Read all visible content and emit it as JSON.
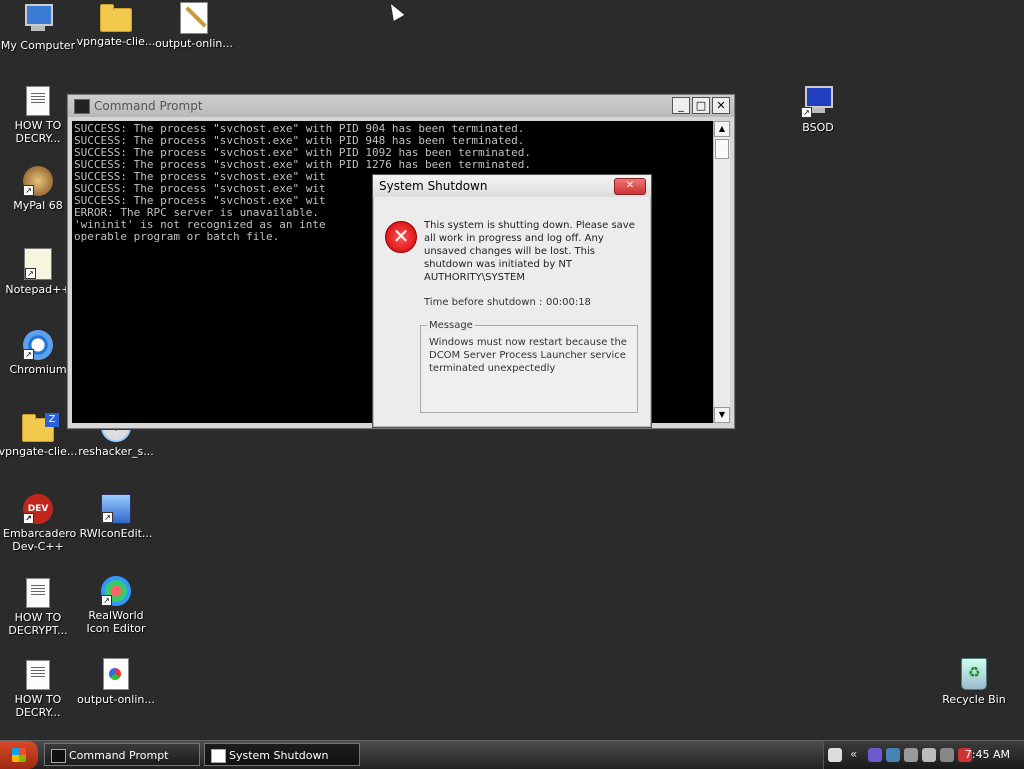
{
  "desktop_icons": [
    {
      "label": "My Computer",
      "icon": "computer-icon"
    },
    {
      "label": "vpngate-clie...",
      "icon": "folder-icon"
    },
    {
      "label": "output-onlin...",
      "icon": "paint-icon"
    },
    {
      "label": "HOW TO DECRY...",
      "icon": "text-file-icon"
    },
    {
      "label": "MyPal 68",
      "icon": "browser-icon"
    },
    {
      "label": "Notepad++",
      "icon": "notepad-icon"
    },
    {
      "label": "Chromium",
      "icon": "chromium-icon"
    },
    {
      "label": "vpngate-clie...",
      "icon": "zip-folder-icon"
    },
    {
      "label": "reshacker_s...",
      "icon": "cd-icon"
    },
    {
      "label": "Embarcadero Dev-C++",
      "icon": "dev-cpp-icon"
    },
    {
      "label": "RWIconEdit...",
      "icon": "setup-icon"
    },
    {
      "label": "HOW TO DECRYPT...",
      "icon": "text-file-icon"
    },
    {
      "label": "RealWorld Icon Editor",
      "icon": "icon-editor-icon"
    },
    {
      "label": "HOW TO DECRY...",
      "icon": "text-file-icon"
    },
    {
      "label": "output-onlin...",
      "icon": "image-file-icon"
    },
    {
      "label": "BSOD",
      "icon": "bsod-icon"
    },
    {
      "label": "Recycle Bin",
      "icon": "recycle-bin-icon"
    }
  ],
  "cmd_window": {
    "title": "Command Prompt",
    "lines": [
      "SUCCESS: The process \"svchost.exe\" with PID 904 has been terminated.",
      "SUCCESS: The process \"svchost.exe\" with PID 948 has been terminated.",
      "SUCCESS: The process \"svchost.exe\" with PID 1092 has been terminated.",
      "SUCCESS: The process \"svchost.exe\" with PID 1276 has been terminated.",
      "SUCCESS: The process \"svchost.exe\" wit",
      "SUCCESS: The process \"svchost.exe\" wit",
      "SUCCESS: The process \"svchost.exe\" wit",
      "ERROR: The RPC server is unavailable.",
      "'wininit' is not recognized as an inte",
      "operable program or batch file."
    ]
  },
  "shutdown_dialog": {
    "title": "System Shutdown",
    "message": "This system is shutting down. Please save all work in progress and log off. Any unsaved changes will be lost. This shutdown was initiated by NT AUTHORITY\\SYSTEM",
    "timer_label": "Time before shutdown :",
    "timer_value": "00:00:18",
    "group_label": "Message",
    "group_text": "Windows must now restart because the DCOM Server Process Launcher service terminated unexpectedly"
  },
  "taskbar": {
    "tasks": [
      {
        "label": "Command Prompt"
      },
      {
        "label": "System Shutdown"
      }
    ],
    "tray_expand": "«",
    "clock": "7:45 AM"
  }
}
